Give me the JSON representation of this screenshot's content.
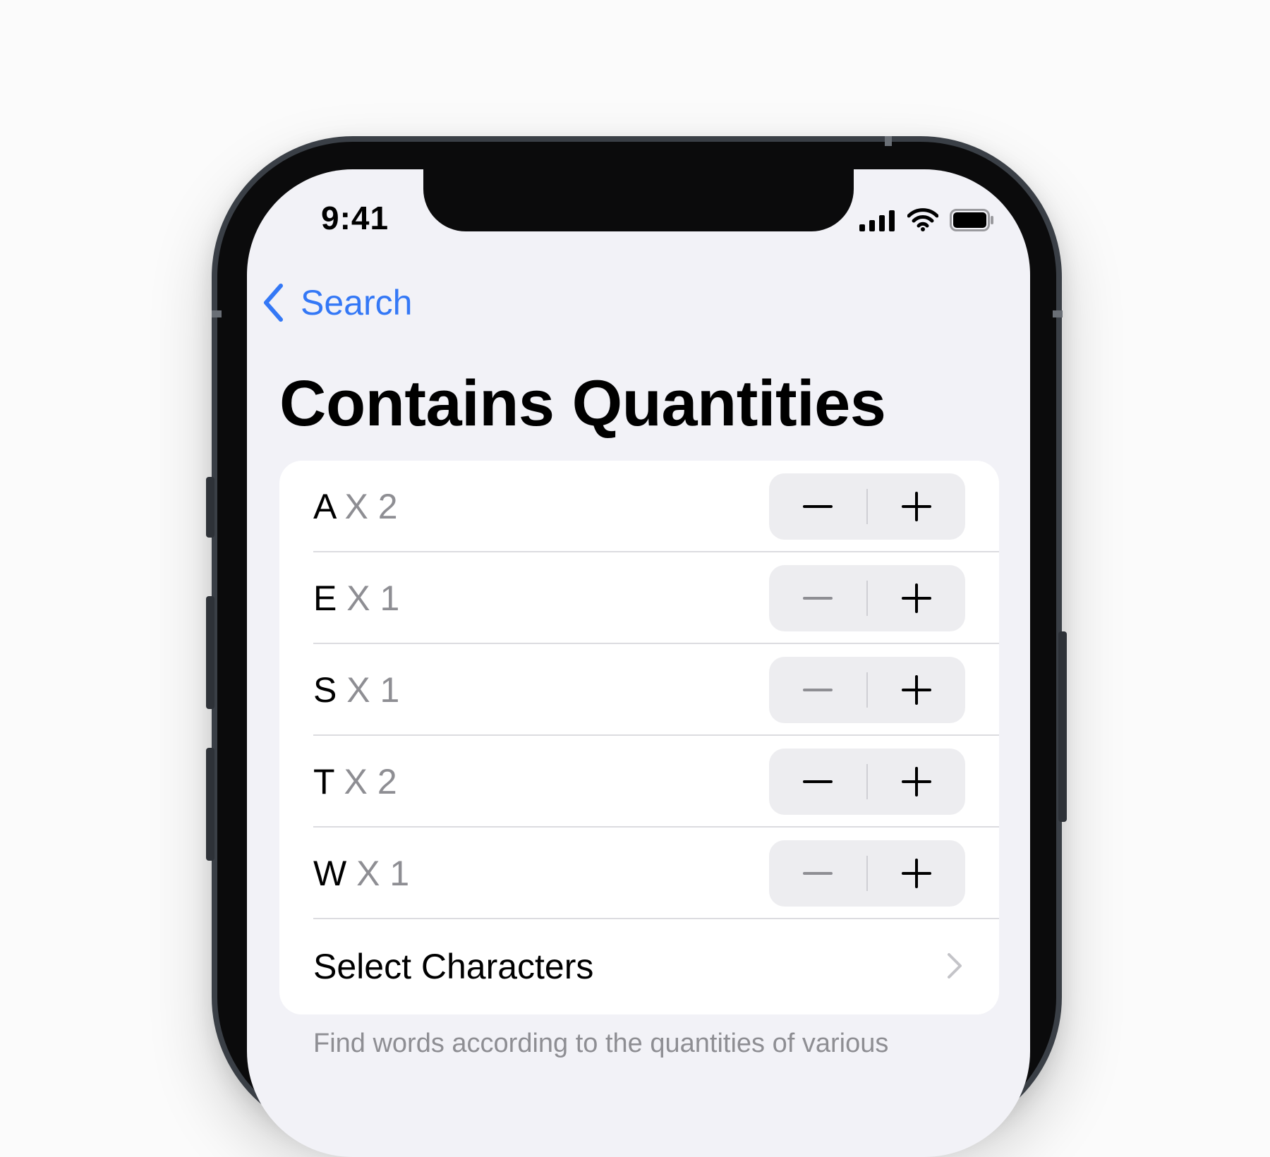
{
  "status_bar": {
    "time": "9:41"
  },
  "nav": {
    "back_label": "Search"
  },
  "title": "Contains Quantities",
  "rows": [
    {
      "letter": "A",
      "times": "X",
      "count": "2",
      "minus_enabled": true
    },
    {
      "letter": "E",
      "times": "X",
      "count": "1",
      "minus_enabled": false
    },
    {
      "letter": "S",
      "times": "X",
      "count": "1",
      "minus_enabled": false
    },
    {
      "letter": "T",
      "times": "X",
      "count": "2",
      "minus_enabled": true
    },
    {
      "letter": "W",
      "times": "X",
      "count": "1",
      "minus_enabled": false
    }
  ],
  "select_characters": "Select Characters",
  "footer": "Find words according to the quantities of various",
  "colors": {
    "accent": "#3478f6",
    "background": "#f2f2f7",
    "secondary_text": "#8e8e93"
  }
}
